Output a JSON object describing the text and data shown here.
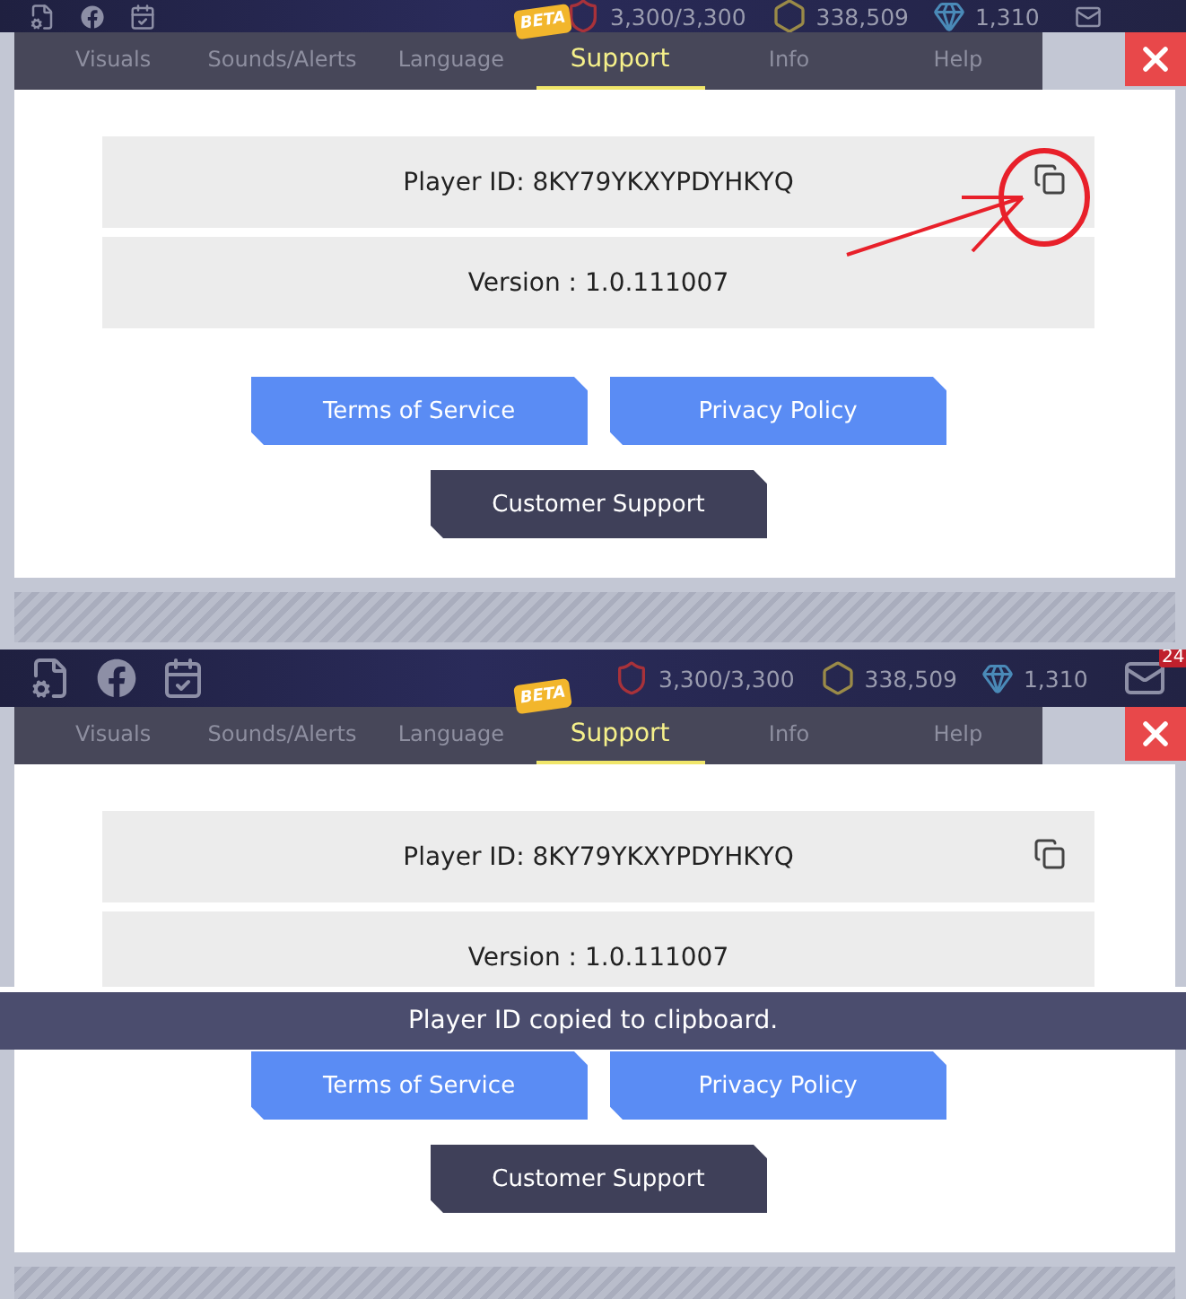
{
  "screens": [
    {
      "hud": {
        "stats": [
          {
            "kind": "energy",
            "value": "3,300/3,300"
          },
          {
            "kind": "gold",
            "value": "338,509"
          },
          {
            "kind": "gem",
            "value": "1,310"
          }
        ]
      },
      "tabs": [
        {
          "label": "Visuals",
          "selected": false
        },
        {
          "label": "Sounds/Alerts",
          "selected": false
        },
        {
          "label": "Language",
          "selected": false
        },
        {
          "label": "Support",
          "selected": true,
          "badge": "BETA"
        },
        {
          "label": "Info",
          "selected": false
        },
        {
          "label": "Help",
          "selected": false
        }
      ],
      "player_id": "Player ID: 8KY79YKXYPDYHKYQ",
      "version": "Version : 1.0.111007",
      "buttons": [
        {
          "label": "Terms of Service",
          "kind": "primary"
        },
        {
          "label": "Privacy Policy",
          "kind": "primary"
        },
        {
          "label": "Customer Support",
          "kind": "secondary"
        }
      ],
      "copy_highlighted": true
    },
    {
      "hud": {
        "stats": [
          {
            "kind": "energy",
            "value": "3,300/3,300"
          },
          {
            "kind": "gold",
            "value": "338,509"
          },
          {
            "kind": "gem",
            "value": "1,310"
          }
        ],
        "mail_badge": "24"
      },
      "tabs": [
        {
          "label": "Visuals",
          "selected": false
        },
        {
          "label": "Sounds/Alerts",
          "selected": false
        },
        {
          "label": "Language",
          "selected": false
        },
        {
          "label": "Support",
          "selected": true,
          "badge": "BETA"
        },
        {
          "label": "Info",
          "selected": false
        },
        {
          "label": "Help",
          "selected": false
        }
      ],
      "player_id": "Player ID: 8KY79YKXYPDYHKYQ",
      "version": "Version : 1.0.111007",
      "buttons": [
        {
          "label": "Terms of Service",
          "kind": "primary"
        },
        {
          "label": "Privacy Policy",
          "kind": "primary"
        },
        {
          "label": "Customer Support",
          "kind": "secondary"
        }
      ],
      "copy_highlighted": false,
      "toast": "Player ID copied to clipboard."
    }
  ]
}
